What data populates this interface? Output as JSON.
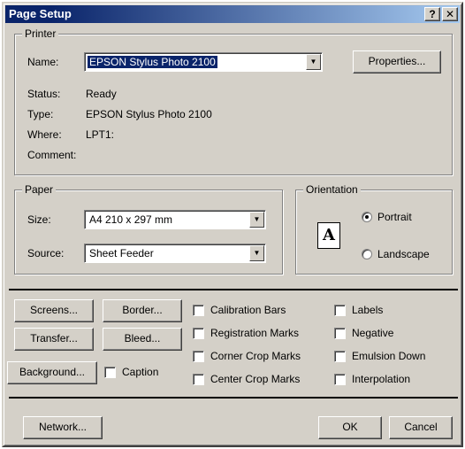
{
  "window": {
    "title": "Page Setup",
    "help_button": "?",
    "close_button": "✕"
  },
  "printer": {
    "legend": "Printer",
    "name_label": "Name:",
    "name_value": "EPSON Stylus Photo 2100",
    "properties_button": "Properties...",
    "status_label": "Status:",
    "status_value": "Ready",
    "type_label": "Type:",
    "type_value": "EPSON Stylus Photo 2100",
    "where_label": "Where:",
    "where_value": "LPT1:",
    "comment_label": "Comment:",
    "comment_value": ""
  },
  "paper": {
    "legend": "Paper",
    "size_label": "Size:",
    "size_value": "A4 210 x 297 mm",
    "source_label": "Source:",
    "source_value": "Sheet Feeder"
  },
  "orientation": {
    "legend": "Orientation",
    "icon_letter": "A",
    "portrait_label": "Portrait",
    "landscape_label": "Landscape",
    "selected": "portrait"
  },
  "options": {
    "screens_button": "Screens...",
    "border_button": "Border...",
    "transfer_button": "Transfer...",
    "bleed_button": "Bleed...",
    "background_button": "Background...",
    "caption_label": "Caption",
    "checkboxes_col1": [
      {
        "label": "Calibration Bars",
        "checked": false
      },
      {
        "label": "Registration Marks",
        "checked": false
      },
      {
        "label": "Corner Crop Marks",
        "checked": false
      },
      {
        "label": "Center Crop Marks",
        "checked": false
      }
    ],
    "checkboxes_col2": [
      {
        "label": "Labels",
        "checked": false
      },
      {
        "label": "Negative",
        "checked": false
      },
      {
        "label": "Emulsion Down",
        "checked": false
      },
      {
        "label": "Interpolation",
        "checked": false
      }
    ]
  },
  "footer": {
    "network_button": "Network...",
    "ok_button": "OK",
    "cancel_button": "Cancel"
  }
}
